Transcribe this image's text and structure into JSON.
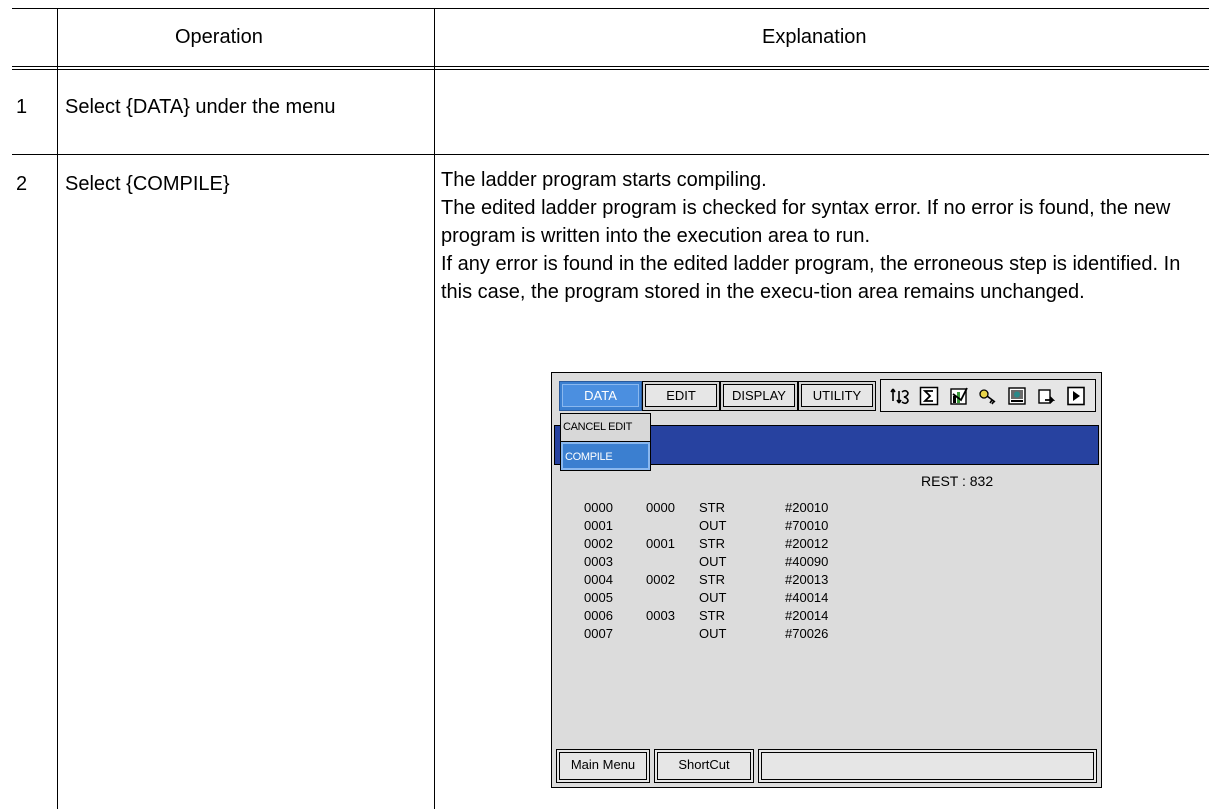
{
  "table": {
    "headers": {
      "operation": "Operation",
      "explanation": "Explanation"
    },
    "rows": [
      {
        "num": "1",
        "operation": "Select {DATA} under the menu",
        "explanation": []
      },
      {
        "num": "2",
        "operation": "Select {COMPILE}",
        "explanation": [
          "The ladder program starts compiling.",
          "The edited ladder program is checked for syntax error.  If no error is found, the new program is written into the execution area to run.",
          "If any error is found in the edited ladder program, the erroneous step is identified.  In this case, the program stored in the execu-tion area remains unchanged."
        ]
      }
    ]
  },
  "screen": {
    "menu": {
      "data": "DATA",
      "edit": "EDIT",
      "display": "DISPLAY",
      "utility": "UTILITY"
    },
    "toolbar_icons": [
      "ladder-toggle-icon",
      "sigma-icon",
      "chart-icon",
      "key-icon",
      "monitor-icon",
      "export-icon",
      "play-icon"
    ],
    "dropdown": {
      "cancel_edit": "CANCEL EDIT",
      "compile": "COMPILE"
    },
    "rest": "REST : 832",
    "program_rows": [
      {
        "line": "0000",
        "step": "0000",
        "op": "STR",
        "dev": "#20010"
      },
      {
        "line": "0001",
        "step": "",
        "op": "OUT",
        "dev": "#70010"
      },
      {
        "line": "0002",
        "step": "0001",
        "op": "STR",
        "dev": "#20012"
      },
      {
        "line": "0003",
        "step": "",
        "op": "OUT",
        "dev": "#40090"
      },
      {
        "line": "0004",
        "step": "0002",
        "op": "STR",
        "dev": "#20013"
      },
      {
        "line": "0005",
        "step": "",
        "op": "OUT",
        "dev": "#40014"
      },
      {
        "line": "0006",
        "step": "0003",
        "op": "STR",
        "dev": "#20014"
      },
      {
        "line": "0007",
        "step": "",
        "op": "OUT",
        "dev": "#70026"
      }
    ],
    "bottom": {
      "main_menu": "Main Menu",
      "shortcut": "ShortCut"
    },
    "colors": {
      "active_menu": "#3b7fd0",
      "title_band": "#2742a0",
      "screen_bg": "#dcdcdc"
    }
  }
}
